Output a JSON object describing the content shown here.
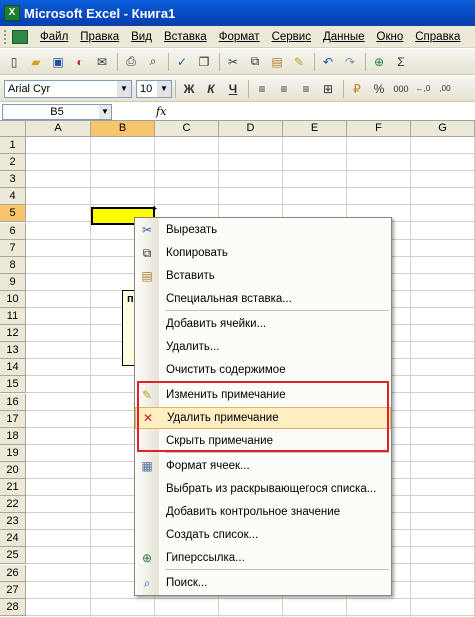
{
  "window": {
    "title": "Microsoft Excel - Книга1",
    "app_icon_glyph": "X"
  },
  "menubar": {
    "items": [
      "Файл",
      "Правка",
      "Вид",
      "Вставка",
      "Формат",
      "Сервис",
      "Данные",
      "Окно",
      "Справка"
    ]
  },
  "toolbar_standard": {
    "icons": [
      "new-icon",
      "open-icon",
      "save-icon",
      "permission-icon",
      "email-icon",
      "print-icon",
      "print-preview-icon",
      "spelling-icon",
      "research-icon",
      "cut-icon",
      "copy-icon",
      "paste-icon",
      "format-painter-icon",
      "undo-icon",
      "redo-icon",
      "hyperlink-icon",
      "autosum-icon"
    ]
  },
  "toolbar_formatting": {
    "font_name": "Arial Cyr",
    "font_size": "10",
    "bold": "Ж",
    "italic": "К",
    "underline": "Ч",
    "percent": "%",
    "thousands": "000",
    "inc_decimal": "←,0",
    "dec_decimal": ",00"
  },
  "formula_bar": {
    "name_box": "B5",
    "fx": "fx"
  },
  "sheet": {
    "columns": [
      "A",
      "B",
      "C",
      "D",
      "E",
      "F",
      "G"
    ],
    "active_column": "B",
    "active_row": 5,
    "rows": [
      "1",
      "2",
      "3",
      "4",
      "5",
      "6",
      "7",
      "8",
      "9",
      "10",
      "11",
      "12",
      "13",
      "14",
      "15",
      "16",
      "17",
      "18",
      "19",
      "20",
      "21",
      "22",
      "23",
      "24",
      "25",
      "26",
      "27",
      "28"
    ],
    "selected_cell_color": "#ffff00",
    "comment_text": "п"
  },
  "context_menu": {
    "items": [
      {
        "label": "Вырезать",
        "icon": "scissors-icon"
      },
      {
        "label": "Копировать",
        "icon": "copy-icon"
      },
      {
        "label": "Вставить",
        "icon": "paste-icon"
      },
      {
        "label": "Специальная вставка...",
        "icon": ""
      },
      {
        "label": "Добавить ячейки...",
        "icon": ""
      },
      {
        "label": "Удалить...",
        "icon": ""
      },
      {
        "label": "Очистить содержимое",
        "icon": ""
      },
      {
        "label": "Изменить примечание",
        "icon": "edit-comment-icon"
      },
      {
        "label": "Удалить примечание",
        "icon": "delete-comment-icon"
      },
      {
        "label": "Скрыть примечание",
        "icon": ""
      },
      {
        "label": "Формат ячеек...",
        "icon": "format-cells-icon"
      },
      {
        "label": "Выбрать из раскрывающегося списка...",
        "icon": ""
      },
      {
        "label": "Добавить контрольное значение",
        "icon": ""
      },
      {
        "label": "Создать список...",
        "icon": ""
      },
      {
        "label": "Гиперссылка...",
        "icon": "hyperlink-icon"
      },
      {
        "label": "Поиск...",
        "icon": "search-icon"
      }
    ],
    "highlighted": "Удалить примечание",
    "highlight_color": "#ffeec2",
    "annotation_color": "#e0202a"
  }
}
